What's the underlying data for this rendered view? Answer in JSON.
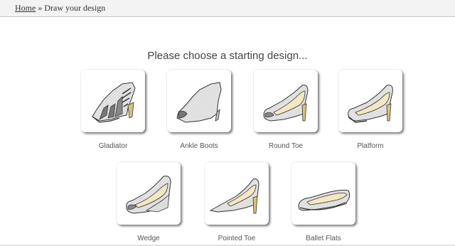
{
  "breadcrumb": {
    "home": "Home",
    "separator": "»",
    "current": "Draw your design"
  },
  "heading": "Please choose a starting design...",
  "designs": [
    {
      "label": "Gladiator"
    },
    {
      "label": "Ankle Boots"
    },
    {
      "label": "Round Toe"
    },
    {
      "label": "Platform"
    },
    {
      "label": "Wedge"
    },
    {
      "label": "Pointed Toe"
    },
    {
      "label": "Ballet Flats"
    }
  ],
  "colors": {
    "shoe_fill": "#e4e4e4",
    "heel_tan": "#d9c27a",
    "insole": "#f4e7c3",
    "outline": "#333333"
  },
  "icons": [
    "gladiator-shoe-icon",
    "ankle-boot-icon",
    "round-toe-shoe-icon",
    "platform-shoe-icon",
    "wedge-shoe-icon",
    "pointed-toe-shoe-icon",
    "ballet-flat-icon"
  ]
}
